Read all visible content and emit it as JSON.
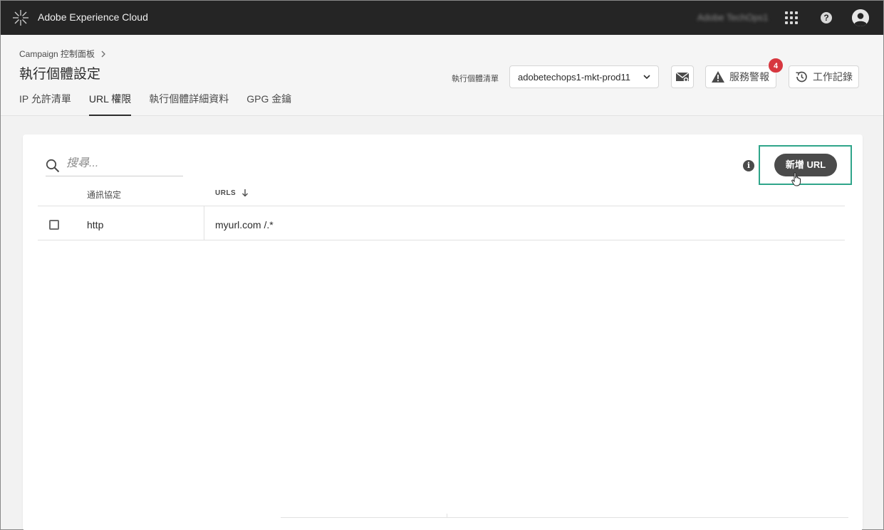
{
  "topbar": {
    "brand": "Adobe Experience Cloud",
    "org": "Adobe TechOps1",
    "icons": [
      "adobe-logo-icon",
      "apps-grid-icon",
      "help-icon",
      "user-avatar-icon"
    ]
  },
  "header": {
    "breadcrumb": "Campaign 控制面板",
    "title": "執行個體設定",
    "tabs": [
      {
        "label": "IP 允許清單",
        "active": false
      },
      {
        "label": "URL 權限",
        "active": true
      },
      {
        "label": "執行個體詳細資料",
        "active": false
      },
      {
        "label": "GPG 金鑰",
        "active": false
      }
    ],
    "instance_label": "執行個體清單",
    "instance_value": "adobetechops1-mkt-prod11",
    "alerts_label": "服務警報",
    "alerts_count": "4",
    "joblog_label": "工作記錄"
  },
  "content": {
    "search_placeholder": "搜尋...",
    "add_button": "新增 URL",
    "columns": {
      "protocol": "通訊協定",
      "urls": "URLS"
    },
    "rows": [
      {
        "protocol": "http",
        "url": "myurl.com /.*"
      }
    ]
  },
  "colors": {
    "topbar_bg": "#252525",
    "primary_button": "#4b4b4b",
    "highlight": "#2fa58a",
    "badge": "#d7373f"
  }
}
